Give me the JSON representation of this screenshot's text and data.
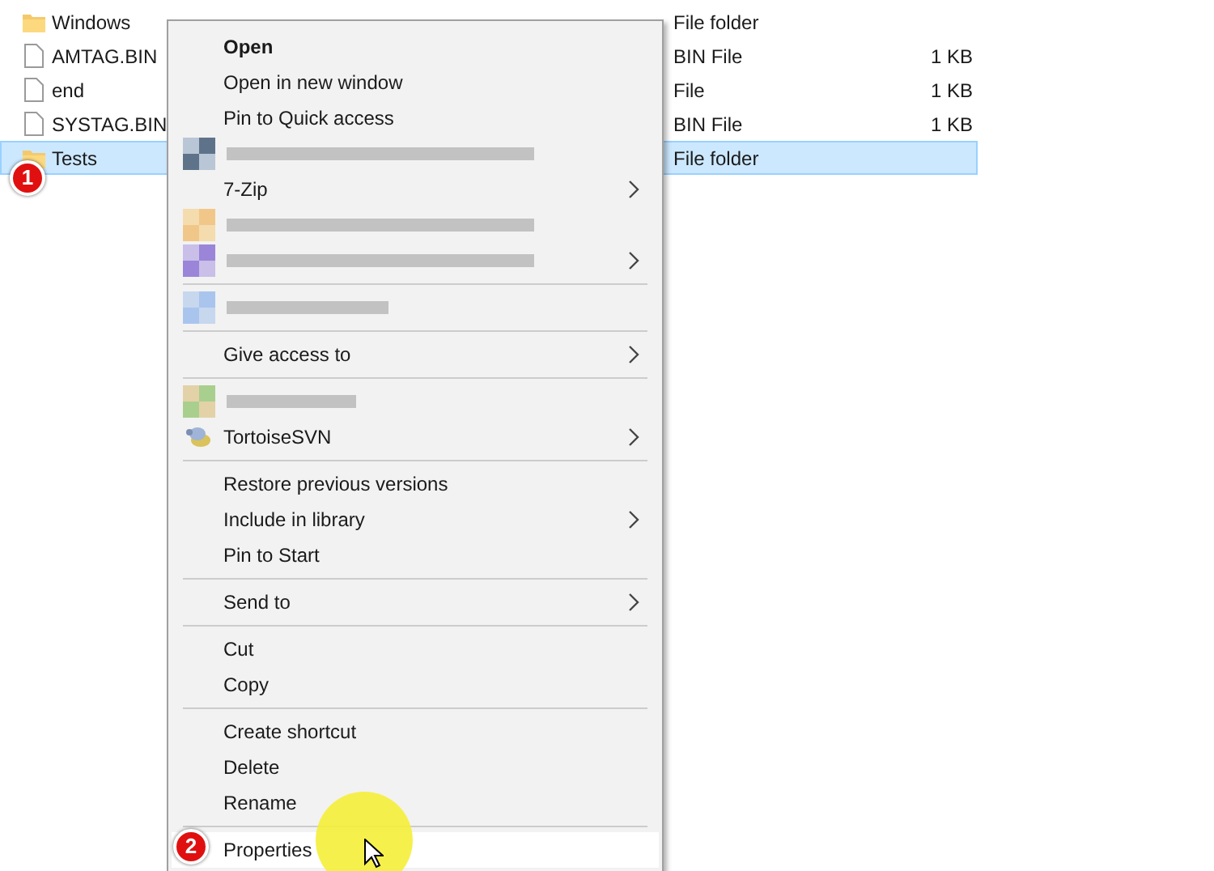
{
  "files": [
    {
      "kind": "folder",
      "name": "Windows",
      "type": "File folder",
      "selected": false
    },
    {
      "kind": "file",
      "name": "AMTAG.BIN",
      "type": "BIN File",
      "size": "1 KB",
      "selected": false
    },
    {
      "kind": "file",
      "name": "end",
      "type": "File",
      "size": "1 KB",
      "selected": false
    },
    {
      "kind": "file",
      "name": "SYSTAG.BIN",
      "type": "BIN File",
      "size": "1 KB",
      "selected": false
    },
    {
      "kind": "folder",
      "name": "Tests",
      "type": "File folder",
      "selected": true
    }
  ],
  "context_menu": {
    "items": [
      {
        "kind": "item",
        "label": "Open",
        "bold": true,
        "submenu": false,
        "selected": false
      },
      {
        "kind": "item",
        "label": "Open in new window",
        "bold": false,
        "submenu": false,
        "selected": false
      },
      {
        "kind": "item",
        "label": "Pin to Quick access",
        "bold": false,
        "submenu": false,
        "selected": false
      },
      {
        "kind": "redacted",
        "submenu": false
      },
      {
        "kind": "item",
        "label": "7-Zip",
        "bold": false,
        "submenu": true,
        "selected": false
      },
      {
        "kind": "redacted",
        "submenu": false
      },
      {
        "kind": "redacted",
        "submenu": true
      },
      {
        "kind": "separator"
      },
      {
        "kind": "redacted",
        "submenu": false
      },
      {
        "kind": "separator"
      },
      {
        "kind": "item",
        "label": "Give access to",
        "bold": false,
        "submenu": true,
        "selected": false
      },
      {
        "kind": "separator"
      },
      {
        "kind": "redacted",
        "submenu": false
      },
      {
        "kind": "turtle_item",
        "label": "TortoiseSVN",
        "bold": false,
        "submenu": true,
        "selected": false
      },
      {
        "kind": "separator"
      },
      {
        "kind": "item",
        "label": "Restore previous versions",
        "bold": false,
        "submenu": false,
        "selected": false
      },
      {
        "kind": "item",
        "label": "Include in library",
        "bold": false,
        "submenu": true,
        "selected": false
      },
      {
        "kind": "item",
        "label": "Pin to Start",
        "bold": false,
        "submenu": false,
        "selected": false
      },
      {
        "kind": "separator"
      },
      {
        "kind": "item",
        "label": "Send to",
        "bold": false,
        "submenu": true,
        "selected": false
      },
      {
        "kind": "separator"
      },
      {
        "kind": "item",
        "label": "Cut",
        "bold": false,
        "submenu": false,
        "selected": false
      },
      {
        "kind": "item",
        "label": "Copy",
        "bold": false,
        "submenu": false,
        "selected": false
      },
      {
        "kind": "separator"
      },
      {
        "kind": "item",
        "label": "Create shortcut",
        "bold": false,
        "submenu": false,
        "selected": false
      },
      {
        "kind": "item",
        "label": "Delete",
        "bold": false,
        "submenu": false,
        "selected": false
      },
      {
        "kind": "item",
        "label": "Rename",
        "bold": false,
        "submenu": false,
        "selected": false
      },
      {
        "kind": "separator"
      },
      {
        "kind": "item",
        "label": "Properties",
        "bold": false,
        "submenu": false,
        "selected": true
      }
    ]
  },
  "step_badges": [
    {
      "label": "1"
    },
    {
      "label": "2"
    }
  ]
}
